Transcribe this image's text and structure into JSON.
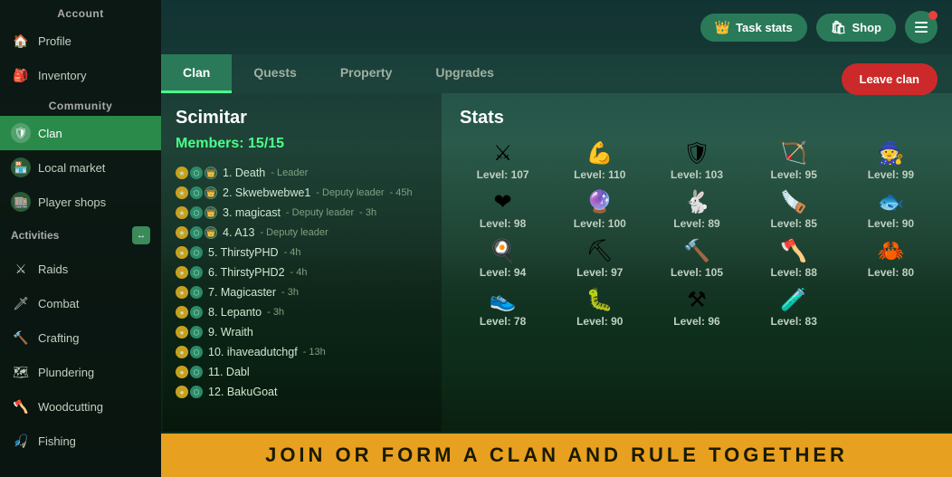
{
  "sidebar": {
    "account_label": "Account",
    "community_label": "Community",
    "activities_label": "Activities",
    "items": [
      {
        "id": "profile",
        "label": "Profile",
        "icon": "🏠"
      },
      {
        "id": "inventory",
        "label": "Inventory",
        "icon": "🎒"
      },
      {
        "id": "clan",
        "label": "Clan",
        "icon": "🛡",
        "active": true
      },
      {
        "id": "local-market",
        "label": "Local market",
        "icon": "🏪"
      },
      {
        "id": "player-shops",
        "label": "Player shops",
        "icon": "🏬"
      },
      {
        "id": "raids",
        "label": "Raids",
        "icon": "⚔"
      },
      {
        "id": "combat",
        "label": "Combat",
        "icon": "🗡"
      },
      {
        "id": "crafting",
        "label": "Crafting",
        "icon": "🔨"
      },
      {
        "id": "plundering",
        "label": "Plundering",
        "icon": "🗺"
      },
      {
        "id": "woodcutting",
        "label": "Woodcutting",
        "icon": "🪓"
      },
      {
        "id": "fishing",
        "label": "Fishing",
        "icon": "🎣"
      }
    ]
  },
  "topbar": {
    "task_stats_label": "Task stats",
    "shop_label": "Shop"
  },
  "tabs": [
    {
      "id": "clan",
      "label": "Clan",
      "active": true
    },
    {
      "id": "quests",
      "label": "Quests"
    },
    {
      "id": "property",
      "label": "Property"
    },
    {
      "id": "upgrades",
      "label": "Upgrades"
    }
  ],
  "clan": {
    "name": "Scimitar",
    "members_label": "Members: 15/15",
    "leave_label": "Leave clan",
    "members": [
      {
        "num": "1.",
        "name": "Death",
        "role": "Leader",
        "time": ""
      },
      {
        "num": "2.",
        "name": "Skwebwebwe1",
        "role": "Deputy leader",
        "time": "45h"
      },
      {
        "num": "3.",
        "name": "magicast",
        "role": "Deputy leader",
        "time": "3h"
      },
      {
        "num": "4.",
        "name": "A13",
        "role": "Deputy leader",
        "time": ""
      },
      {
        "num": "5.",
        "name": "ThirstyPHD",
        "role": "",
        "time": "4h"
      },
      {
        "num": "6.",
        "name": "ThirstyPHD2",
        "role": "",
        "time": "4h"
      },
      {
        "num": "7.",
        "name": "Magicaster",
        "role": "",
        "time": "3h"
      },
      {
        "num": "8.",
        "name": "Lepanto",
        "role": "",
        "time": "3h"
      },
      {
        "num": "9.",
        "name": "Wraith",
        "role": "",
        "time": ""
      },
      {
        "num": "10.",
        "name": "ihaveadutchgf",
        "role": "",
        "time": "13h"
      },
      {
        "num": "11.",
        "name": "Dabl",
        "role": "",
        "time": ""
      },
      {
        "num": "12.",
        "name": "BakuGoat",
        "role": "",
        "time": ""
      }
    ]
  },
  "stats": {
    "title": "Stats",
    "items": [
      {
        "icon": "⚔",
        "level": "Level: 107"
      },
      {
        "icon": "💪",
        "level": "Level: 110"
      },
      {
        "icon": "🛡",
        "level": "Level: 103"
      },
      {
        "icon": "🏹",
        "level": "Level: 95"
      },
      {
        "icon": "🧙",
        "level": "Level: 99"
      },
      {
        "icon": "❤",
        "level": "Level: 98"
      },
      {
        "icon": "🔮",
        "level": "Level: 100"
      },
      {
        "icon": "🐇",
        "level": "Level: 89"
      },
      {
        "icon": "🪚",
        "level": "Level: 85"
      },
      {
        "icon": "🐟",
        "level": "Level: 90"
      },
      {
        "icon": "🍳",
        "level": "Level: 94"
      },
      {
        "icon": "⛏",
        "level": "Level: 97"
      },
      {
        "icon": "🔨",
        "level": "Level: 105"
      },
      {
        "icon": "🪓",
        "level": "Level: 88"
      },
      {
        "icon": "🦀",
        "level": "Level: 80"
      },
      {
        "icon": "👟",
        "level": "Level: 78"
      },
      {
        "icon": "🐛",
        "level": "Level: 90"
      },
      {
        "icon": "⚒",
        "level": "Level: 96"
      },
      {
        "icon": "🧪",
        "level": "Level: 83"
      }
    ]
  },
  "banner": {
    "text": "JOIN  OR  FORM  A  CLAN  AND  RULE  TOGETHER"
  }
}
